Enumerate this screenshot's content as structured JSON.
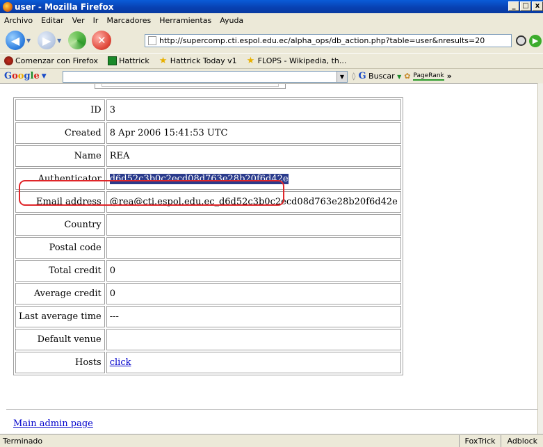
{
  "window": {
    "title": "user - Mozilla Firefox",
    "buttons": [
      "_",
      "□",
      "x"
    ]
  },
  "menu": [
    "Archivo",
    "Editar",
    "Ver",
    "Ir",
    "Marcadores",
    "Herramientas",
    "Ayuda"
  ],
  "address": {
    "url": "http://supercomp.cti.espol.edu.ec/alpha_ops/db_action.php?table=user&nresults=20"
  },
  "bookmarks": [
    "Comenzar con Firefox",
    "Hattrick",
    "Hattrick Today v1",
    "FLOPS - Wikipedia, th..."
  ],
  "google_toolbar": {
    "logo": "Google",
    "search_label": "Buscar",
    "pagerank_label": "PageRank",
    "more": "»"
  },
  "record": {
    "rows": [
      {
        "label": "ID",
        "value": "3"
      },
      {
        "label": "Created",
        "value": "8 Apr 2006 15:41:53 UTC"
      },
      {
        "label": "Name",
        "value": "REA"
      },
      {
        "label": "Authenticator",
        "value": "d6d52c3b0c2ecd08d763e28b20f6d42e"
      },
      {
        "label": "Email address",
        "value": "@rea@cti.espol.edu.ec_d6d52c3b0c2ecd08d763e28b20f6d42e"
      },
      {
        "label": "Country",
        "value": ""
      },
      {
        "label": "Postal code",
        "value": ""
      },
      {
        "label": "Total credit",
        "value": "0"
      },
      {
        "label": "Average credit",
        "value": "0"
      },
      {
        "label": "Last average time",
        "value": "---"
      },
      {
        "label": "Default venue",
        "value": ""
      },
      {
        "label": "Hosts",
        "value": "click"
      }
    ]
  },
  "footer_link": "Main admin page",
  "status": {
    "text": "Terminado",
    "panes": [
      "FoxTrick",
      "Adblock"
    ]
  },
  "colors": {
    "highlight": "#2a3b8c",
    "annotation": "#e0262a",
    "link": "#0000cc"
  }
}
